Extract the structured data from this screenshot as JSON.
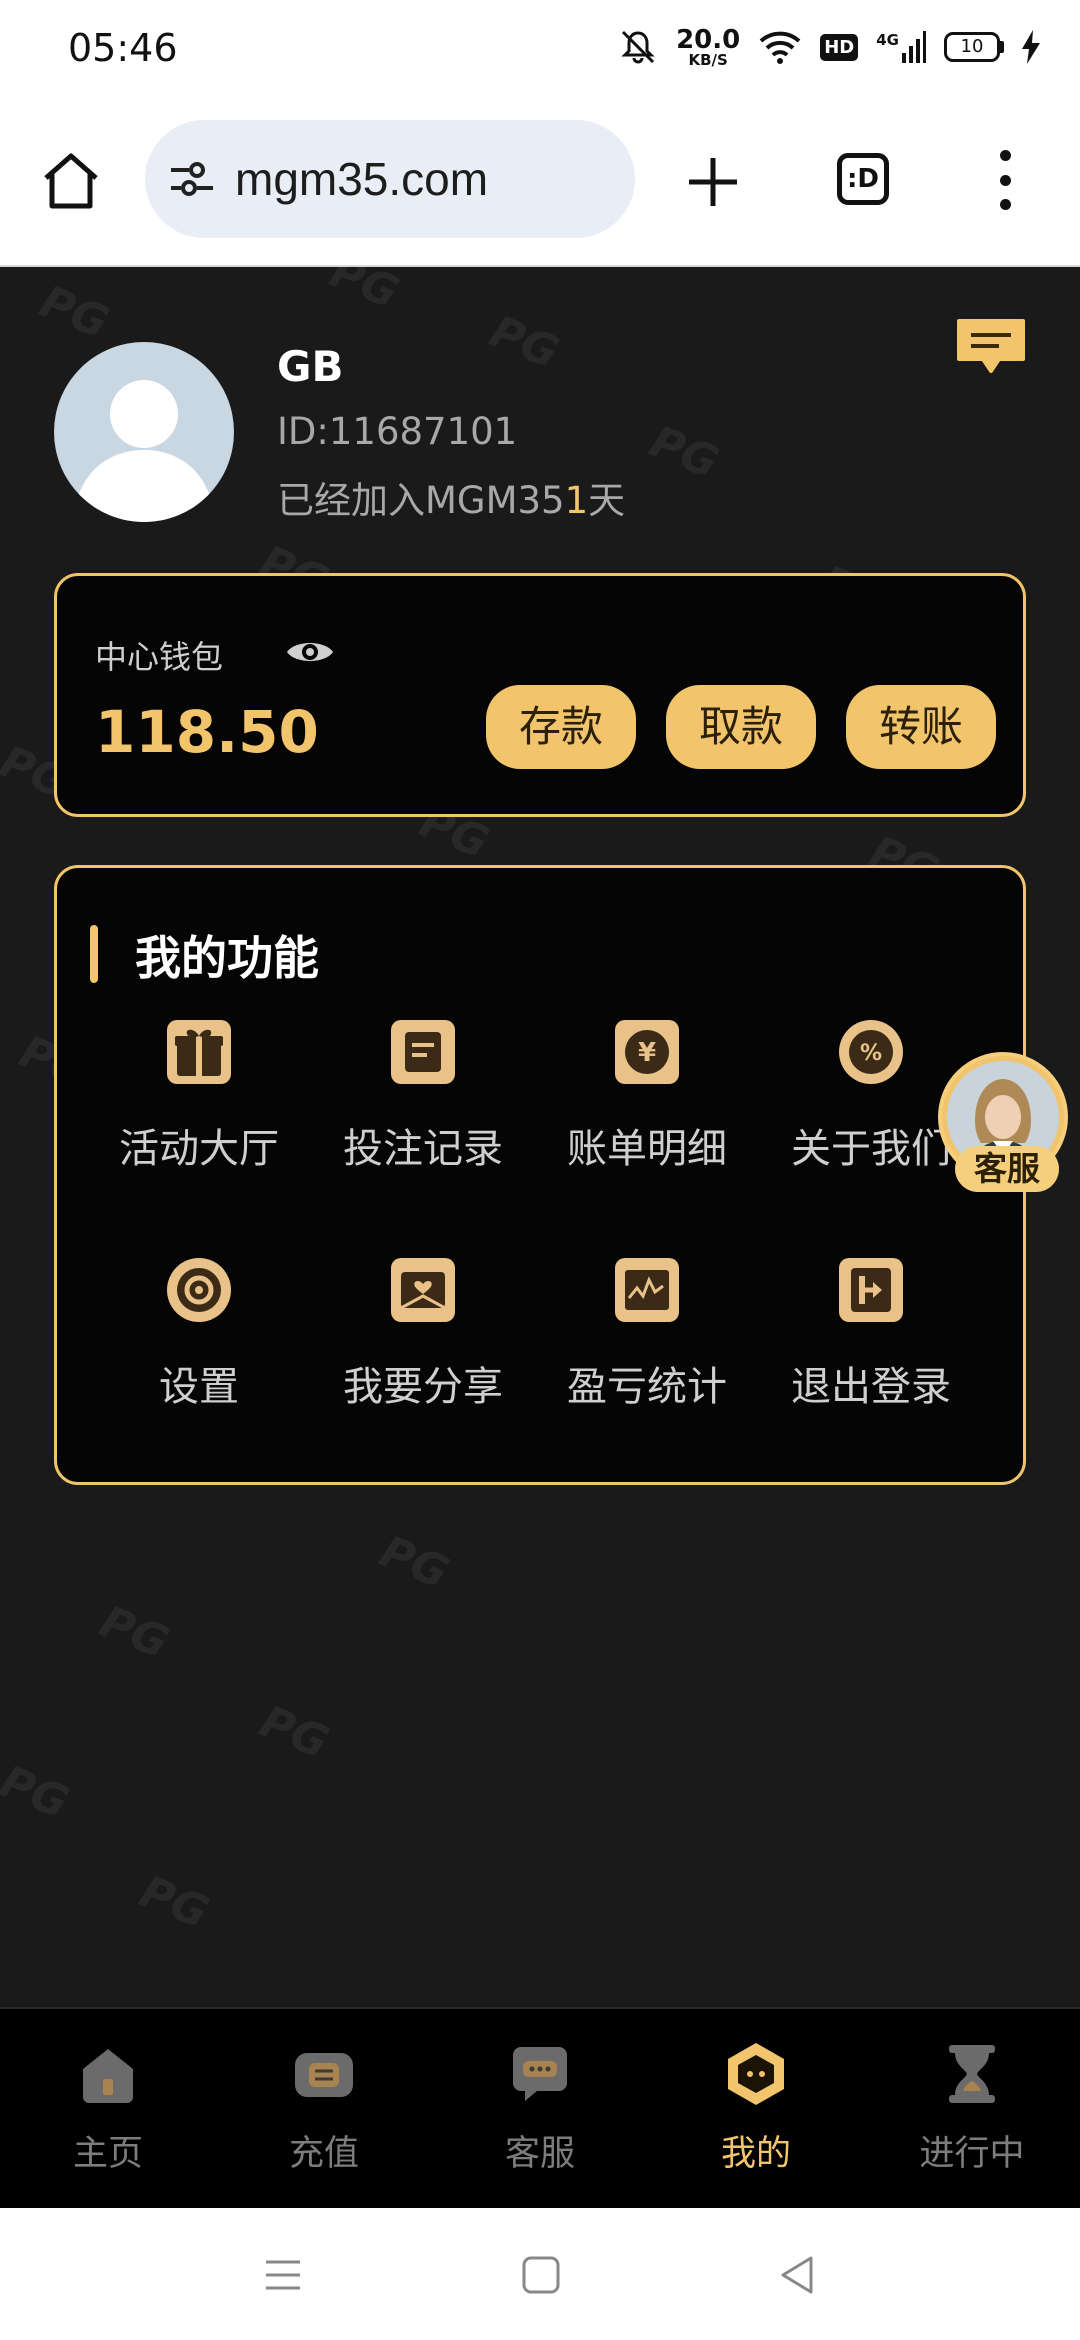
{
  "status_bar": {
    "time": "05:46",
    "net_speed": "20.0",
    "net_unit": "KB/S",
    "hd": "HD",
    "signal": "4G",
    "battery": "10"
  },
  "browser": {
    "url": "mgm35.com",
    "tabs_label": ":D"
  },
  "profile": {
    "name": "GB",
    "id_text": "ID:11687101",
    "joined_prefix": "已经加入MGM35",
    "joined_days": "1",
    "joined_suffix": "天"
  },
  "wallet": {
    "label": "中心钱包",
    "balance": "118.50",
    "buttons": [
      "存款",
      "取款",
      "转账"
    ]
  },
  "functions": {
    "title": "我的功能",
    "items": [
      {
        "label": "活动大厅",
        "icon": "gift-icon"
      },
      {
        "label": "投注记录",
        "icon": "bet-record-icon"
      },
      {
        "label": "账单明细",
        "icon": "yen-coin-icon"
      },
      {
        "label": "关于我们",
        "icon": "percent-icon"
      },
      {
        "label": "设置",
        "icon": "gear-icon"
      },
      {
        "label": "我要分享",
        "icon": "share-envelope-icon"
      },
      {
        "label": "盈亏统计",
        "icon": "chart-icon"
      },
      {
        "label": "退出登录",
        "icon": "logout-icon"
      }
    ]
  },
  "customer_service_float": {
    "label": "客服"
  },
  "bottom_nav": {
    "items": [
      {
        "label": "主页",
        "icon": "home-icon"
      },
      {
        "label": "充值",
        "icon": "wallet-icon"
      },
      {
        "label": "客服",
        "icon": "chat-icon"
      },
      {
        "label": "我的",
        "icon": "profile-icon",
        "active": true
      },
      {
        "label": "进行中",
        "icon": "hourglass-icon"
      }
    ]
  },
  "watermark": "PG",
  "colors": {
    "background": "#1a1a1a",
    "accent": "#f2c46c",
    "panel": "#050505",
    "text_muted": "#a8a8a8"
  }
}
